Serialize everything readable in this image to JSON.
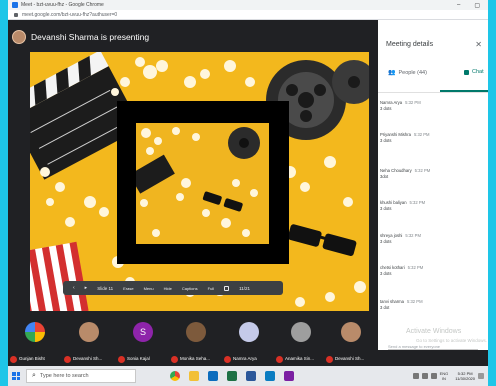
{
  "browser": {
    "window_title": "Meet - bzt-uvuu-fhz - Google Chrome",
    "url": "meet.google.com/bzt-uvuu-fhz?authuser=0",
    "window_controls": [
      "–",
      "▢"
    ]
  },
  "meeting": {
    "presenter_text": "Devanshi Sharma is presenting"
  },
  "share_toolbar": {
    "slide_label": "Slide 11",
    "slide_count": "11/21",
    "tool_labels": [
      "Erase",
      "Menu",
      "Hide",
      "Captions",
      "Full"
    ]
  },
  "panel": {
    "title": "Meeting details",
    "close_icon": "close-icon",
    "tabs": [
      {
        "label": "People (44)",
        "icon": "people-icon"
      },
      {
        "label": "Chat",
        "icon": "chat-icon"
      }
    ],
    "messages": [
      {
        "name": "Namra Arya",
        "time": "5:32 PM",
        "text": "3 dots"
      },
      {
        "name": "Priyanshi Mishra",
        "time": "5:32 PM",
        "text": "3 dots"
      },
      {
        "name": "Neha Choudhary",
        "time": "5:32 PM",
        "text": "3dot"
      },
      {
        "name": "khushi baliyan",
        "time": "5:32 PM",
        "text": "3 dots"
      },
      {
        "name": "shreya joshi",
        "time": "5:32 PM",
        "text": "3 dots"
      },
      {
        "name": "chetsi kothari",
        "time": "5:32 PM",
        "text": "3 dots"
      },
      {
        "name": "tanvi sharma",
        "time": "5:32 PM",
        "text": "3 dot"
      }
    ],
    "activate_title": "Activate Windows",
    "activate_sub": "Go to Settings to activate Windows.",
    "input_placeholder": "Send a message to everyone"
  },
  "participants": [
    {
      "name": "Gunjan Bisht",
      "avatar_color": "#e8eaed"
    },
    {
      "name": "Devanshi Sh...",
      "avatar_color": "#b98b6a"
    },
    {
      "name": "Sonia Kajal",
      "avatar_color": "#8e24aa",
      "initial": "S"
    },
    {
      "name": "Monika Seha...",
      "avatar_color": "#7d5a3c"
    },
    {
      "name": "Namra Arya",
      "avatar_color": "#c5cae9"
    },
    {
      "name": "Anamika Sin...",
      "avatar_color": "#9e9e9e"
    },
    {
      "name": "Devanshi Sh...",
      "avatar_color": "#b98b6a"
    }
  ],
  "taskbar": {
    "search_placeholder": "Type here to search",
    "apps": [
      "chrome-icon",
      "file-explorer-icon",
      "store-icon",
      "excel-icon",
      "word-icon",
      "edge-icon",
      "photos-icon"
    ],
    "language": "ENG",
    "region": "IN",
    "time": "5:32 PM",
    "date": "11/30/2020"
  }
}
